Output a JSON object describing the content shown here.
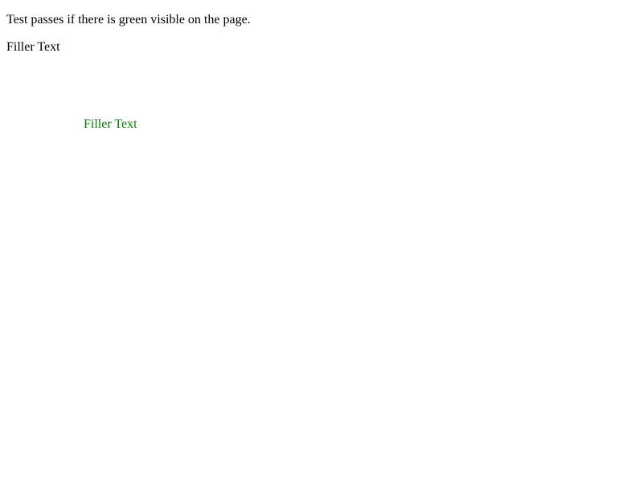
{
  "instruction_text": "Test passes if there is green visible on the page.",
  "filler_text_plain": "Filler Text",
  "filler_text_green": "Filler Text",
  "colors": {
    "text": "#000000",
    "green": "#008000",
    "background": "#ffffff"
  }
}
